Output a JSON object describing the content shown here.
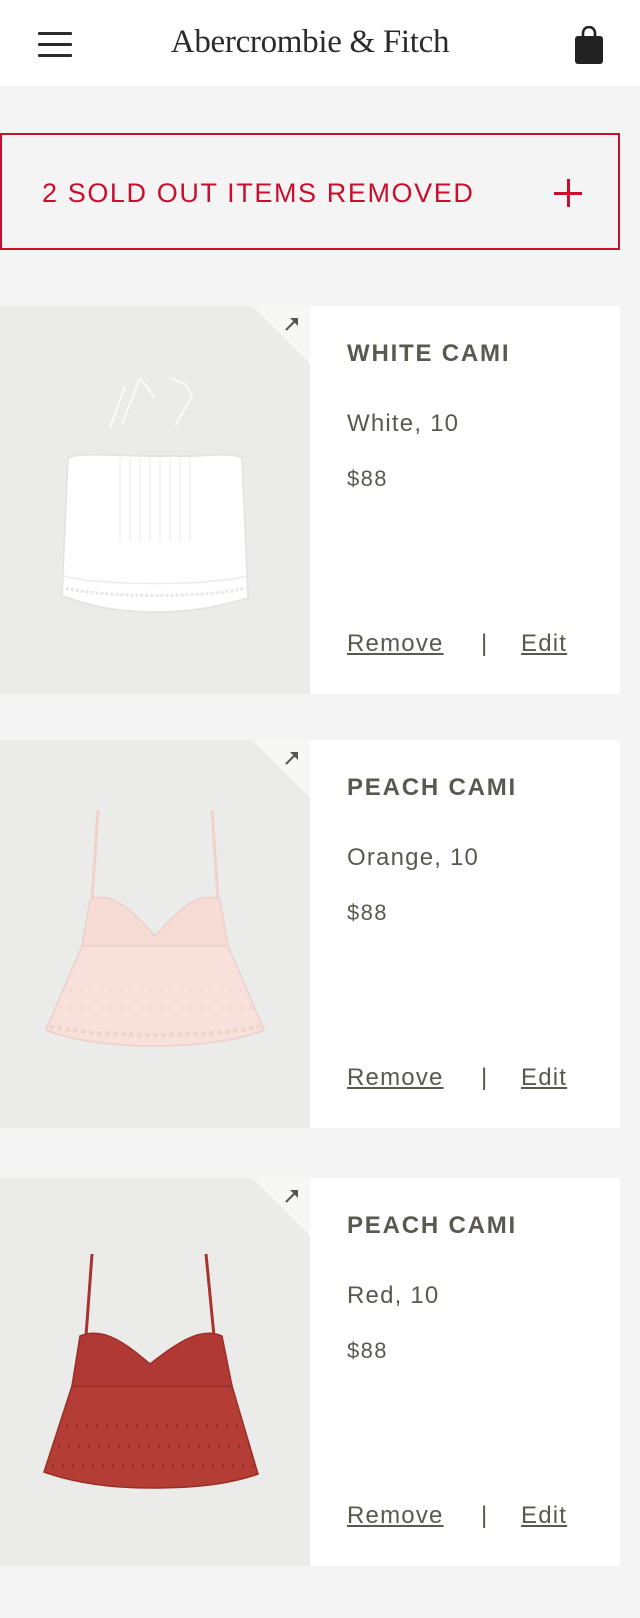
{
  "header": {
    "logo_text": "Abercrombie & Fitch",
    "menu_icon": "hamburger-menu-icon",
    "bag_icon": "shopping-bag-icon"
  },
  "notice": {
    "text": "2 SOLD OUT ITEMS REMOVED",
    "icon": "plus-icon",
    "color": "#c8102e"
  },
  "items": [
    {
      "name": "WHITE CAMI",
      "variant": "White, 10",
      "price": "$88",
      "remove_label": "Remove",
      "separator": "|",
      "edit_label": "Edit",
      "garment_color": "#ffffff"
    },
    {
      "name": "PEACH CAMI",
      "variant": "Orange, 10",
      "price": "$88",
      "remove_label": "Remove",
      "separator": "|",
      "edit_label": "Edit",
      "garment_color": "#f6dcd4"
    },
    {
      "name": "PEACH CAMI",
      "variant": "Red, 10",
      "price": "$88",
      "remove_label": "Remove",
      "separator": "|",
      "edit_label": "Edit",
      "garment_color": "#b03a33"
    }
  ]
}
